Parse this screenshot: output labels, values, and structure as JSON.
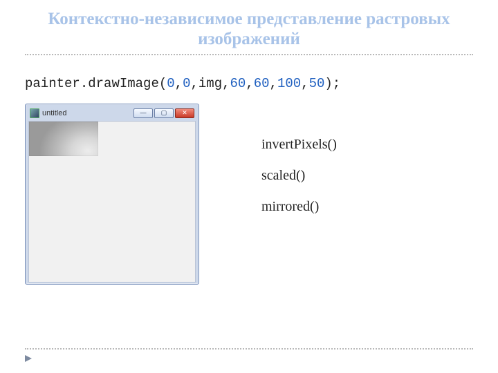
{
  "slide": {
    "title": "Контекстно-независимое представление растровых изображений"
  },
  "code": {
    "obj": "painter",
    "dot": ".",
    "fn": "drawImage",
    "p_open": "(",
    "a0": "0",
    "c1": ",",
    "a1": "0",
    "c2": ",",
    "a2": "img",
    "c3": ",",
    "a3": "60",
    "c4": ",",
    "a4": "60",
    "c5": ",",
    "a5": "100",
    "c6": ",",
    "a6": "50",
    "p_close": ")",
    "semi": ";"
  },
  "window": {
    "title": "untitled",
    "min_glyph": "—",
    "max_glyph": "▢",
    "close_glyph": "✕"
  },
  "methods": {
    "m0": "invertPixels()",
    "m1": "scaled()",
    "m2": "mirrored()"
  }
}
